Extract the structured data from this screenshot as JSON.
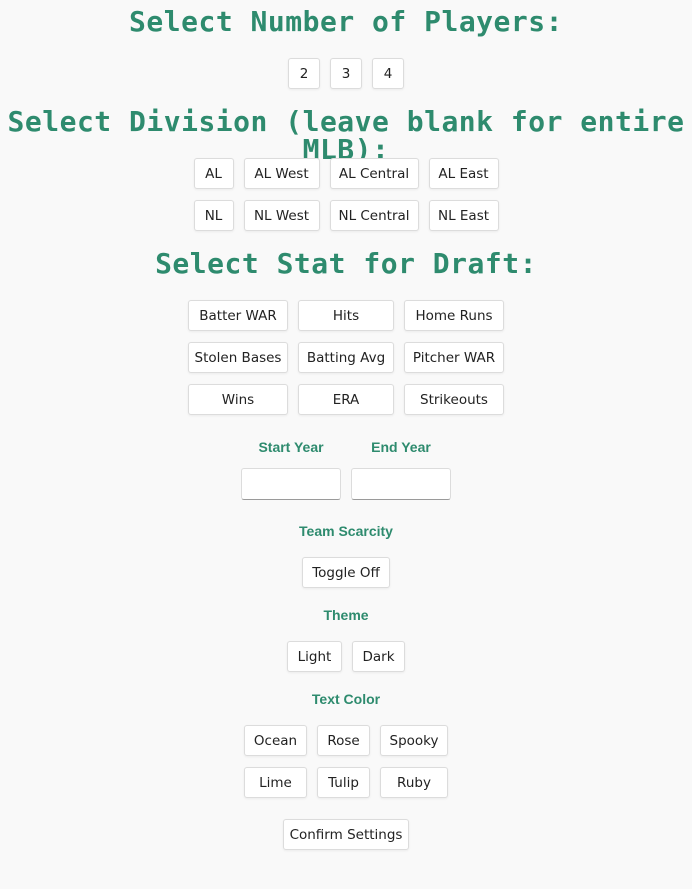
{
  "players": {
    "heading": "Select Number of Players:",
    "options": [
      "2",
      "3",
      "4"
    ]
  },
  "division": {
    "heading": "Select Division (leave blank for entire MLB):",
    "row1": [
      "AL",
      "AL West",
      "AL Central",
      "AL East"
    ],
    "row2": [
      "NL",
      "NL West",
      "NL Central",
      "NL East"
    ]
  },
  "stat": {
    "heading": "Select Stat for Draft:",
    "row1": [
      "Batter WAR",
      "Hits",
      "Home Runs"
    ],
    "row2": [
      "Stolen Bases",
      "Batting Avg",
      "Pitcher WAR"
    ],
    "row3": [
      "Wins",
      "ERA",
      "Strikeouts"
    ]
  },
  "years": {
    "start_label": "Start Year",
    "end_label": "End Year",
    "start_value": "",
    "end_value": ""
  },
  "team_scarcity": {
    "label": "Team Scarcity",
    "toggle_label": "Toggle Off"
  },
  "theme": {
    "label": "Theme",
    "options": [
      "Light",
      "Dark"
    ]
  },
  "text_color": {
    "label": "Text Color",
    "row1": [
      "Ocean",
      "Rose",
      "Spooky"
    ],
    "row2": [
      "Lime",
      "Tulip",
      "Ruby"
    ]
  },
  "confirm_label": "Confirm Settings",
  "colors": {
    "accent": "#2e8b6e",
    "background": "#f9f9f9",
    "button_bg": "#ffffff",
    "button_border": "#dcdcdc"
  }
}
